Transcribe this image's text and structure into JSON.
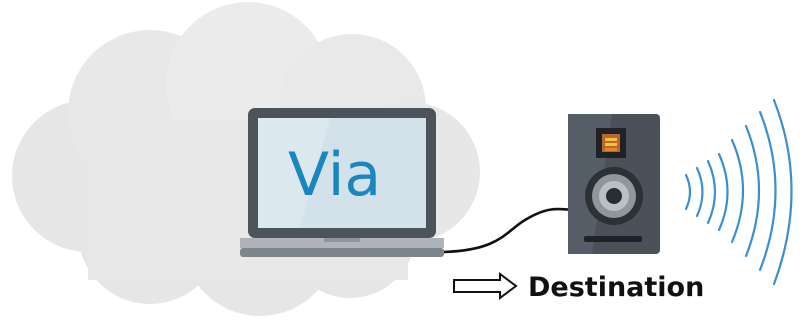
{
  "laptop": {
    "screen_text": "Via",
    "screen_text_color": "#1a86be"
  },
  "destination": {
    "label": "Destination"
  },
  "colors": {
    "cloud": "#eaeaea",
    "speaker_body": "#4a5159",
    "sound_waves": "#3a8fd0"
  },
  "icons": [
    "cloud-icon",
    "laptop-icon",
    "cable-icon",
    "speaker-icon",
    "sound-waves-icon",
    "right-arrow-icon"
  ]
}
